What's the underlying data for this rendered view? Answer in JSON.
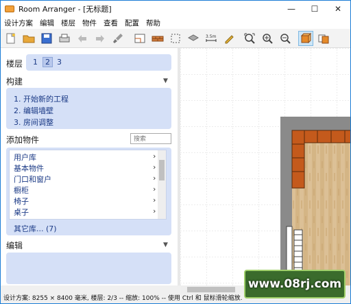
{
  "window": {
    "title": "Room Arranger - [无标题]",
    "min": "—",
    "max": "☐",
    "close": "✕"
  },
  "menu": [
    "设计方案",
    "编辑",
    "楼层",
    "物件",
    "查看",
    "配置",
    "帮助"
  ],
  "floors": {
    "label": "楼层",
    "items": [
      "1",
      "2",
      "3"
    ],
    "selected": "2"
  },
  "build": {
    "title": "构建",
    "items": [
      "1. 开始新的工程",
      "2. 编辑墙壁",
      "3. 房间调整"
    ]
  },
  "add_objects": {
    "title": "添加物件",
    "search_placeholder": "搜索",
    "libs": [
      "用户库",
      "基本物件",
      "门口和窗户",
      "橱柜",
      "椅子",
      "桌子"
    ],
    "more": "其它库... (7)"
  },
  "edit": {
    "title": "编辑"
  },
  "status": "设计方案: 8255 × 8400 毫米, 楼层: 2/3 -- 缩放: 100% -- 使用 Ctrl 和 鼠标滑轮缩放.",
  "watermark": "www.08rj.com",
  "colors": {
    "accent": "#1a7cd6",
    "panel": "#d5e0f7",
    "link": "#1b3a86",
    "wall": "#8a8a8a",
    "cabinet": "#c45a1c",
    "floor": "#d9b98a"
  }
}
